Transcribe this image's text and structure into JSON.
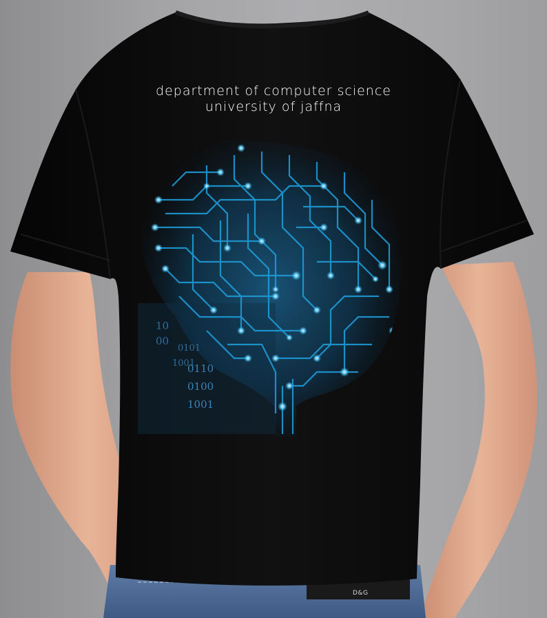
{
  "print": {
    "line1": "department of computer science",
    "line2": "university of jaffna"
  },
  "binary_lines": [
    "10",
    "00",
    "0101",
    "1001",
    "0110",
    "0100",
    "1001"
  ],
  "belt_label": "D&G",
  "colors": {
    "background": "#a6a6a8",
    "shirt": "#0b0b0c",
    "skin": "#e2ad92",
    "circuit": "#1e9bd6",
    "glow": "#6fd6ff",
    "jeans": "#4d6b96"
  }
}
